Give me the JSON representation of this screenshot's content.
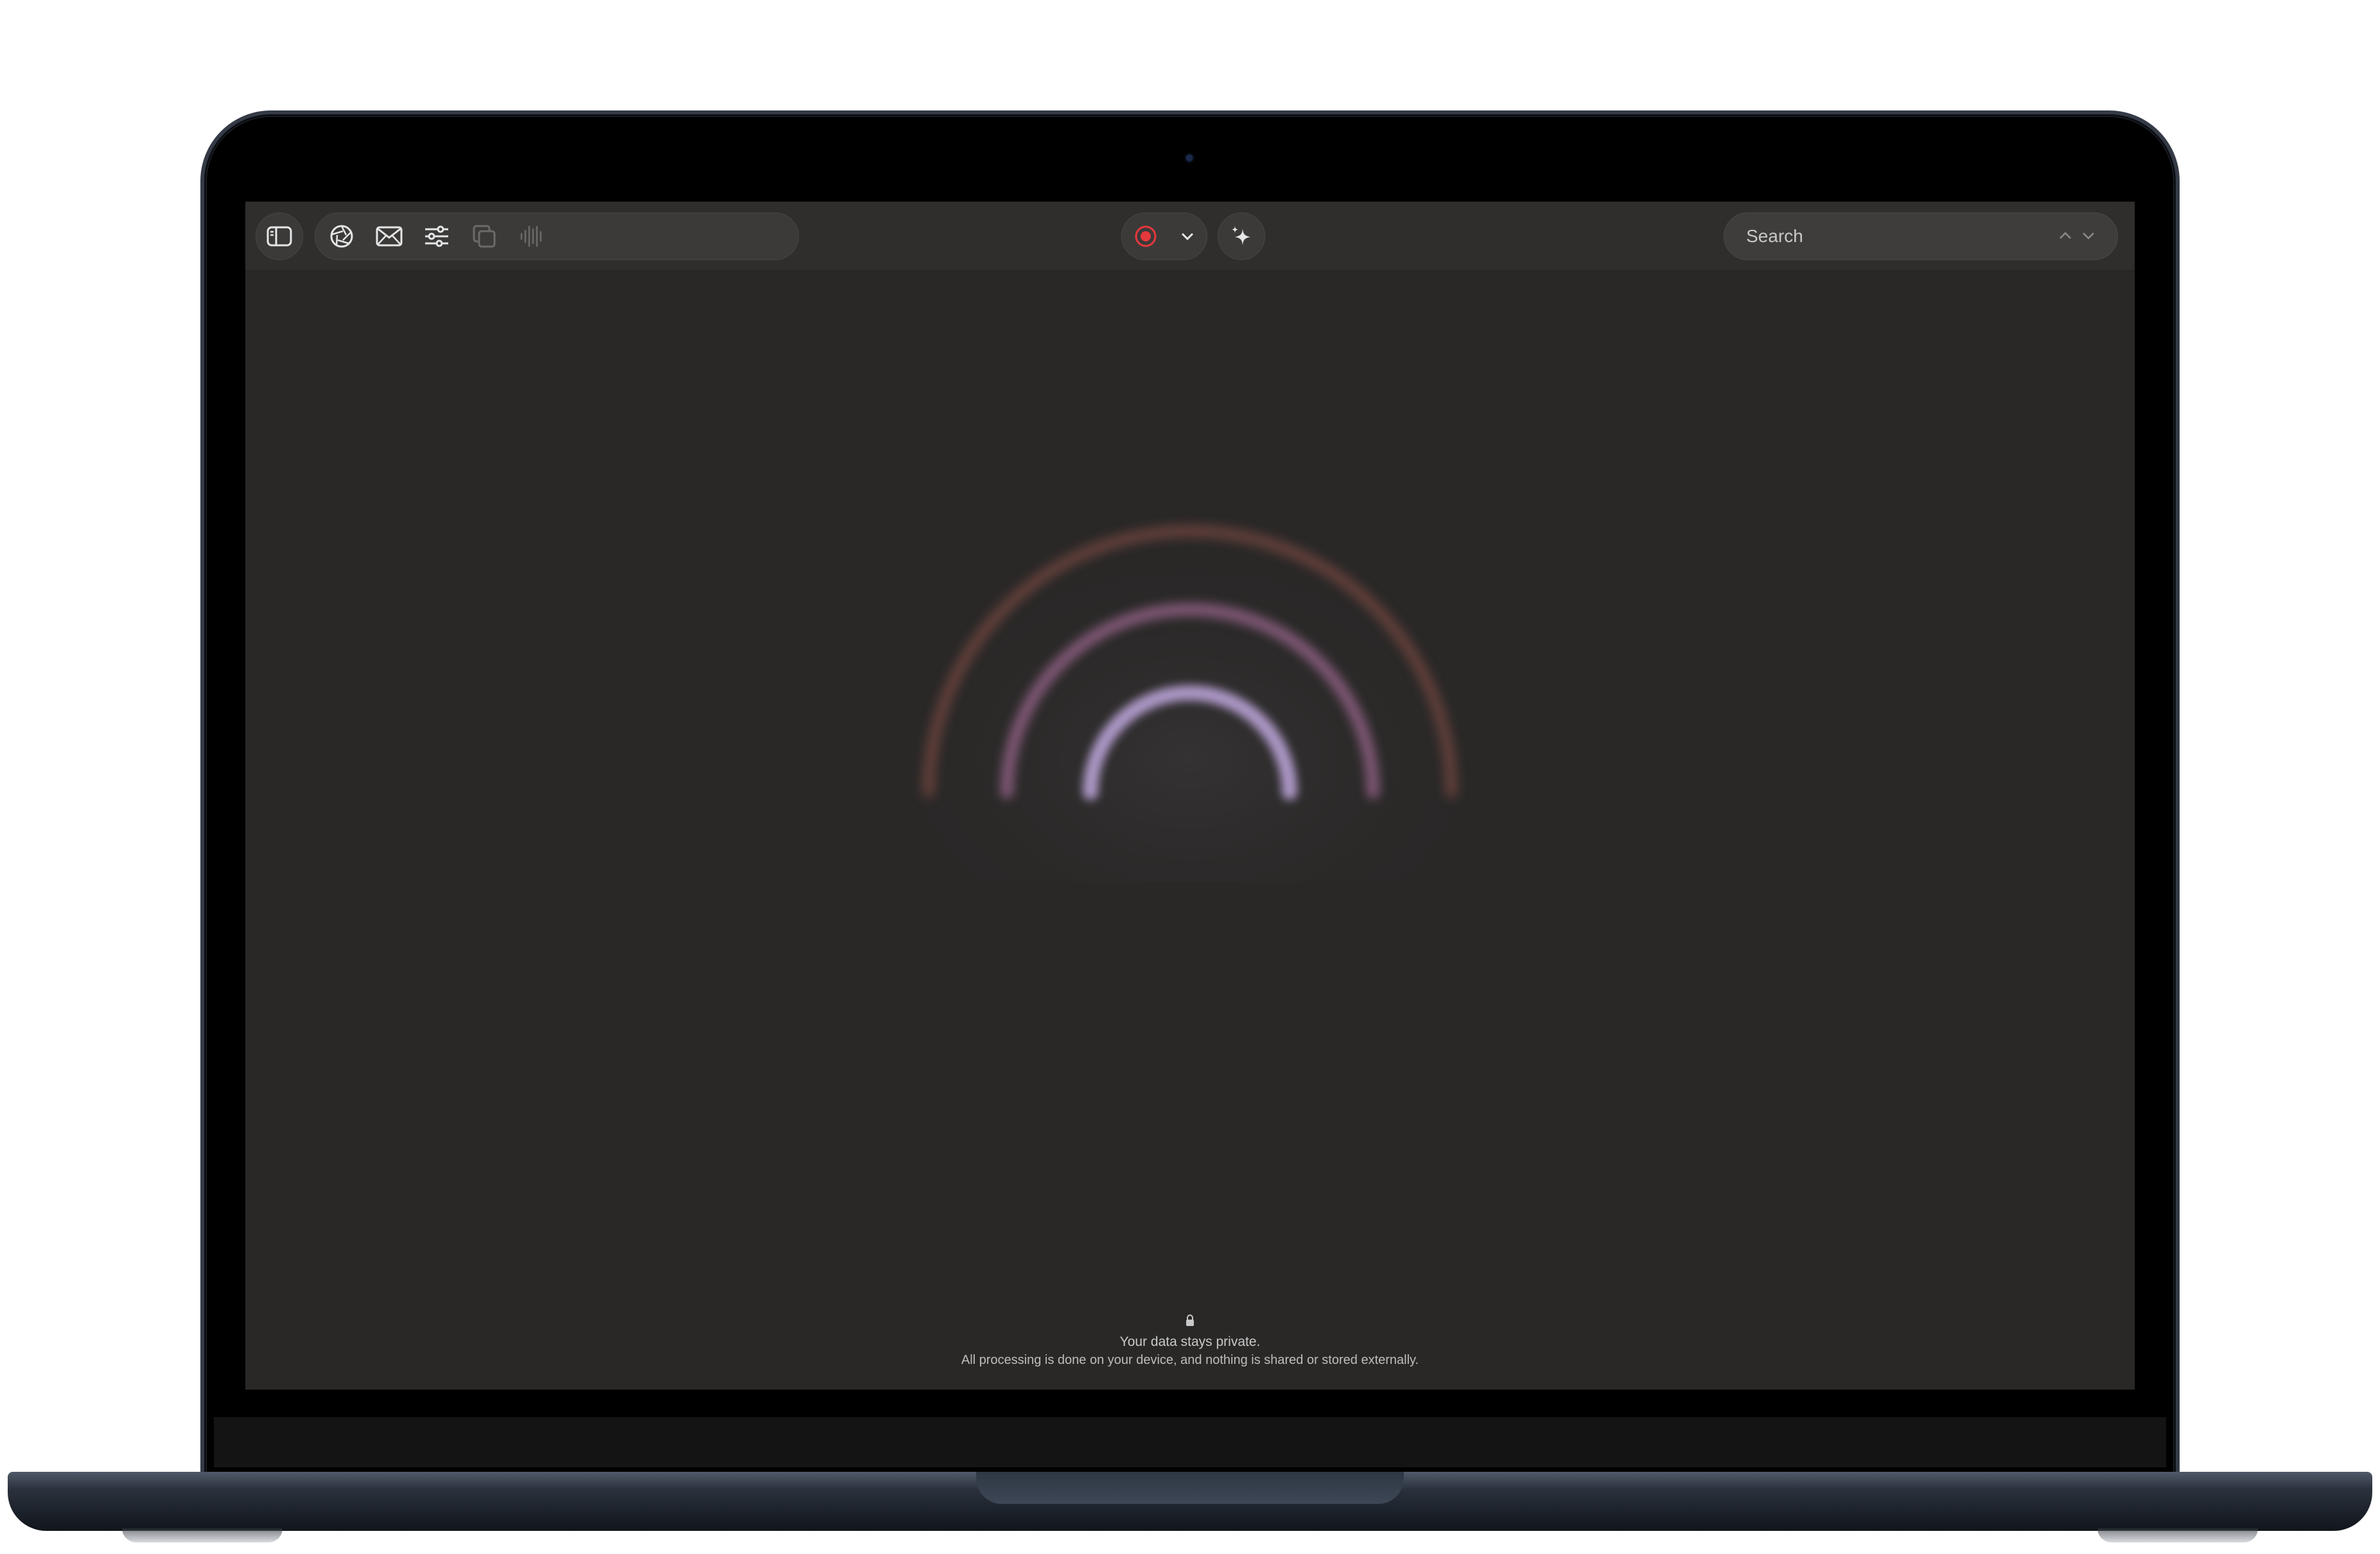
{
  "toolbar": {
    "sidebar_toggle_icon": "sidebar-icon",
    "tools": [
      {
        "name": "aperture-icon",
        "enabled": true
      },
      {
        "name": "mail-icon",
        "enabled": true
      },
      {
        "name": "sliders-icon",
        "enabled": true
      },
      {
        "name": "copy-icon",
        "enabled": false
      },
      {
        "name": "waveform-icon",
        "enabled": false
      }
    ],
    "record_icon": "record-icon",
    "record_dropdown_icon": "chevron-down-icon",
    "ai_icon": "sparkles-icon",
    "record_color": "#e5383b"
  },
  "search": {
    "placeholder": "Search",
    "value": ""
  },
  "privacy": {
    "title": "Your data stays private.",
    "body": "All processing is done on your device, and nothing is shared or stored externally."
  },
  "colors": {
    "background": "#292827",
    "wave_outer": "#7a4a43",
    "wave_middle": "#8a5d7f",
    "wave_inner": "#b9a3d6"
  }
}
